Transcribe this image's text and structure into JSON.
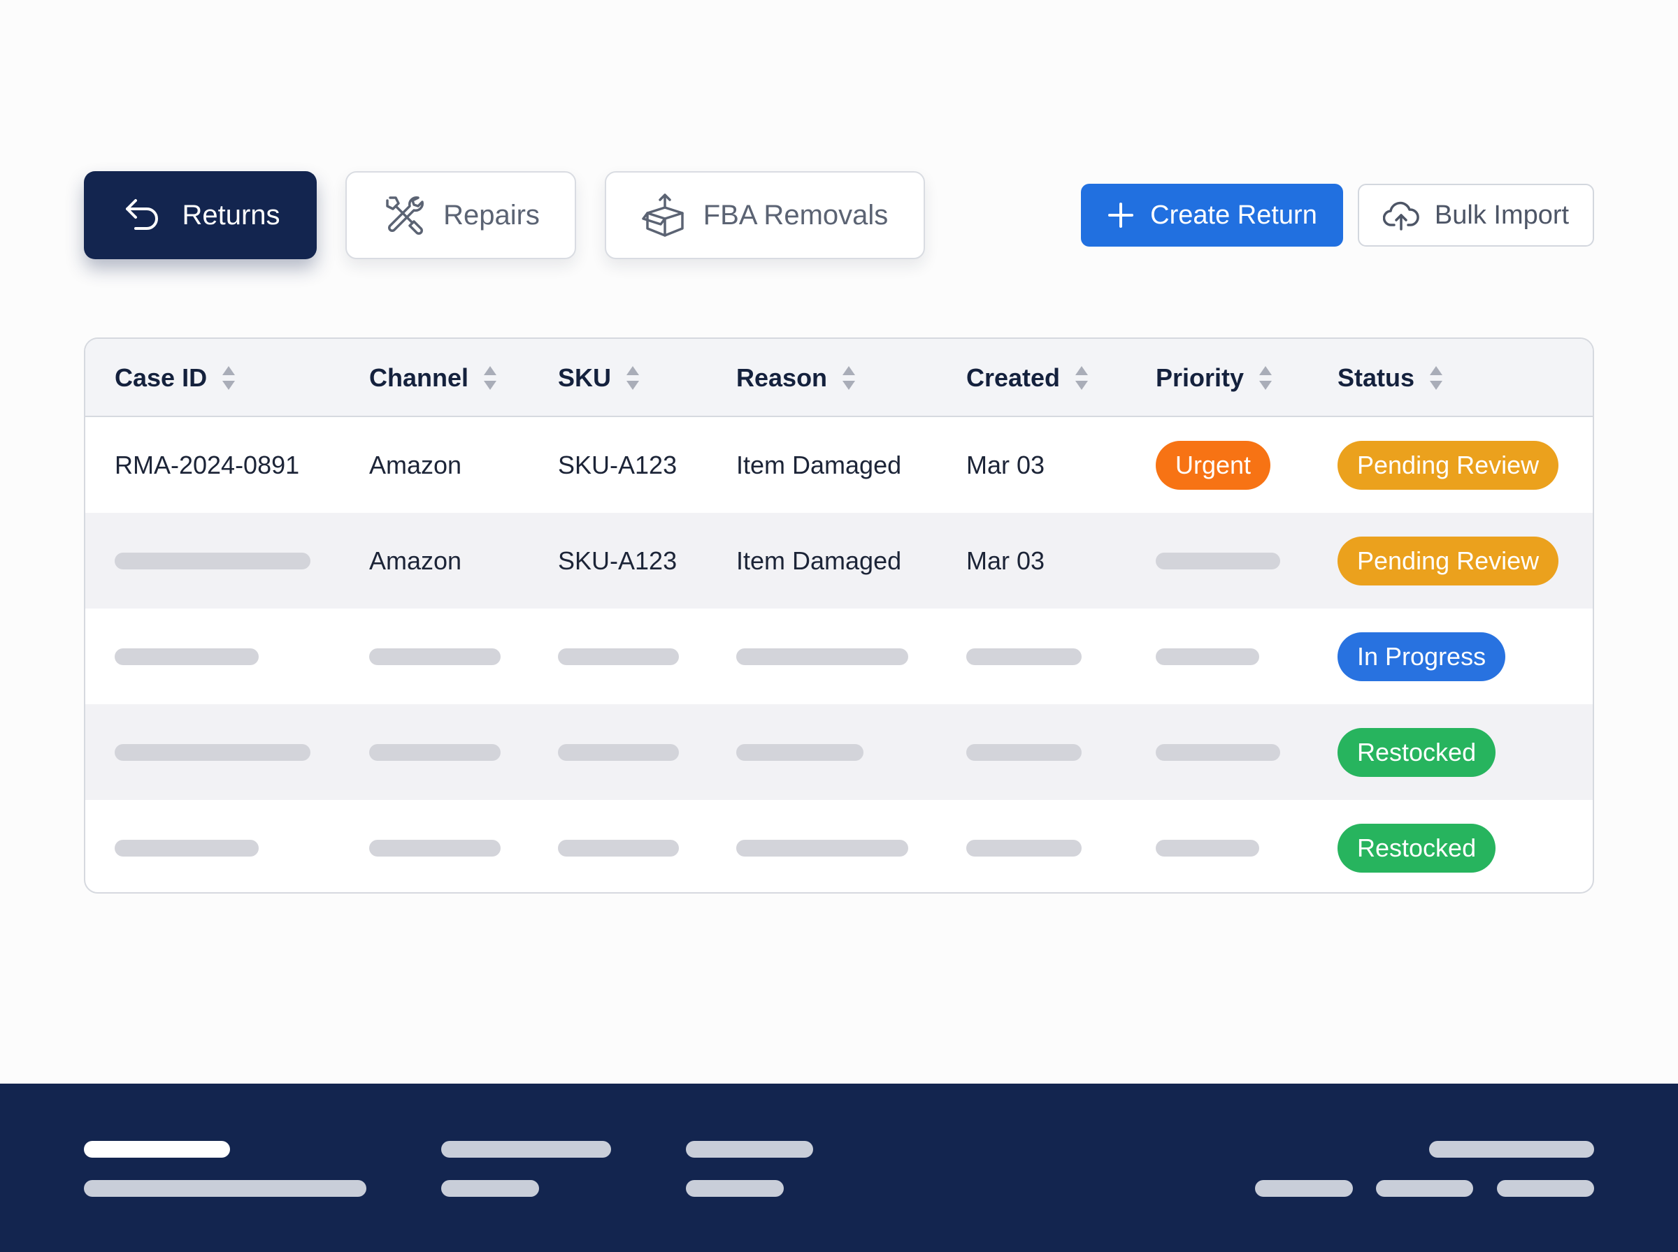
{
  "toolbar": {
    "tabs": [
      {
        "label": "Returns",
        "active": true,
        "icon": "return-arrow-icon"
      },
      {
        "label": "Repairs",
        "active": false,
        "icon": "tools-icon"
      },
      {
        "label": "FBA Removals",
        "active": false,
        "icon": "box-icon"
      }
    ],
    "create_label": "Create Return",
    "import_label": "Bulk Import"
  },
  "table": {
    "columns": [
      "Case ID",
      "Channel",
      "SKU",
      "Reason",
      "Created",
      "Priority",
      "Status"
    ],
    "rows": [
      {
        "case_id": "RMA-2024-0891",
        "channel": "Amazon",
        "sku": "SKU-A123",
        "reason": "Item Damaged",
        "created": "Mar 03",
        "priority": "Urgent",
        "status": "Pending Review"
      },
      {
        "case_id": "",
        "channel": "Amazon",
        "sku": "SKU-A123",
        "reason": "Item Damaged",
        "created": "Mar 03",
        "priority": "",
        "status": "Pending Review"
      },
      {
        "case_id": "",
        "channel": "",
        "sku": "",
        "reason": "",
        "created": "",
        "priority": "",
        "status": "In Progress"
      },
      {
        "case_id": "",
        "channel": "",
        "sku": "",
        "reason": "",
        "created": "",
        "priority": "",
        "status": "Restocked"
      },
      {
        "case_id": "",
        "channel": "",
        "sku": "",
        "reason": "",
        "created": "",
        "priority": "",
        "status": "Restocked"
      }
    ]
  },
  "colors": {
    "navy": "#13254f",
    "primary_blue": "#2170e0",
    "urgent": "#f77314",
    "pending_review": "#eba11d",
    "in_progress": "#2872e0",
    "restocked": "#27b45e"
  }
}
